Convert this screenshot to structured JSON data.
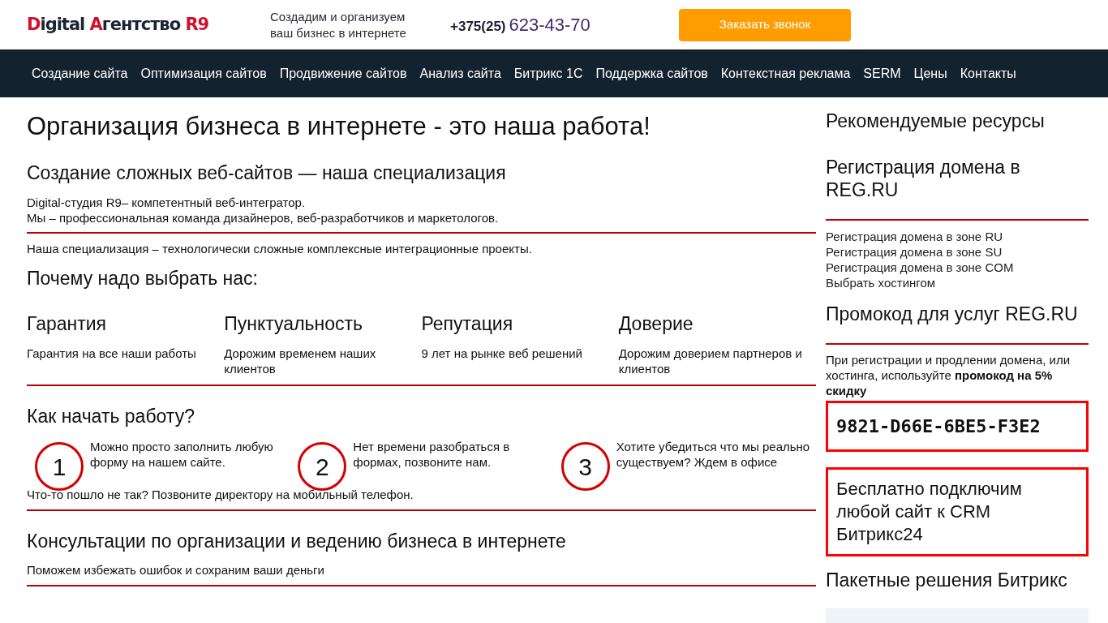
{
  "header": {
    "logo": [
      {
        "text": "D",
        "accent": true
      },
      {
        "text": "igital ",
        "accent": false
      },
      {
        "text": "А",
        "accent": true
      },
      {
        "text": "гентство ",
        "accent": false
      },
      {
        "text": "R9",
        "accent": true
      }
    ],
    "tagline": [
      "Создадим и организуем",
      "ваш бизнес в интернете"
    ],
    "phone": {
      "prefix": "+375(25)",
      "number": "623-43-70"
    },
    "callback_button": "Заказать звонок"
  },
  "nav": [
    "Создание сайта",
    "Оптимизация сайтов",
    "Продвижение сайтов",
    "Анализ сайта",
    "Битрикс 1С",
    "Поддержка сайтов",
    "Контекстная реклама",
    "SERM",
    "Цены",
    "Контакты"
  ],
  "main": {
    "title": "Организация бизнеса в интернете - это наша работа!",
    "specialization": {
      "heading": "Создание сложных веб-сайтов — наша специализация",
      "lines": [
        "Digital-студия R9– компетентный веб-интегратор.",
        "Мы – профессиональная команда дизайнеров, веб-разработчиков и маркетологов."
      ],
      "note": "Наша специализация – технологически сложные комплексные интеграционные проекты."
    },
    "why": {
      "heading": "Почему надо выбрать нас:",
      "items": [
        {
          "title": "Гарантия",
          "text": "Гарантия на все наши работы"
        },
        {
          "title": "Пунктуальность",
          "text": "Дорожим временем наших клиентов"
        },
        {
          "title": "Репутация",
          "text": "9 лет на рынке веб решений"
        },
        {
          "title": "Доверие",
          "text": "Дорожим доверием партнеров и клиентов"
        }
      ]
    },
    "start": {
      "heading": "Как начать работу?",
      "steps": [
        {
          "number": "1",
          "text": "Можно просто заполнить любую форму на нашем сайте."
        },
        {
          "number": "2",
          "text": "Нет времени разобраться в формах, позвоните нам."
        },
        {
          "number": "3",
          "text": "Хотите убедиться что мы реально существуем? Ждем в офисе"
        }
      ],
      "note": "Что-то пошло не так? Позвоните директору на мобильный телефон."
    },
    "consult": {
      "heading": "Консультации по организации и ведению бизнеса в интернете",
      "text": "Поможем избежать ошибок и сохраним ваши деньги"
    }
  },
  "sidebar": {
    "title": "Рекомендуемые ресурсы",
    "domain_heading": "Регистрация домена в REG.RU",
    "links": [
      "Регистрация домена в зоне RU",
      "Регистрация домена в зоне SU",
      "Регистрация домена в зоне COM",
      "Выбрать хостингом"
    ],
    "promo_heading": "Промокод для услуг REG.RU",
    "promo_text": "При регистрации и продлении домена, или хостинга, используйте **промокод на 5% скидку**",
    "promo_code": "9821-D66E-6BE5-F3E2",
    "crm_text": "Бесплатно подключим любой сайт к CRM Битрикс24",
    "packages_heading": "Пакетные решения Битрикс"
  }
}
